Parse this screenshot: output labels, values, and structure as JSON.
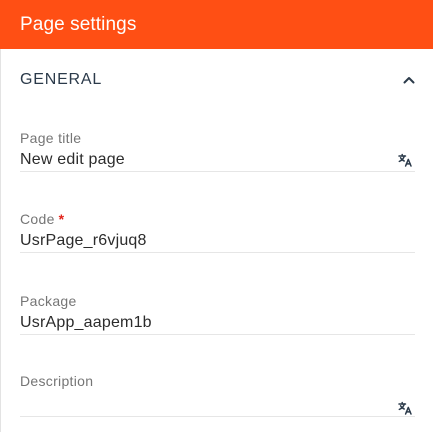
{
  "header": {
    "title": "Page settings"
  },
  "section": {
    "title": "GENERAL",
    "toggle_icon": "chevron-up-icon"
  },
  "fields": {
    "page_title": {
      "label": "Page title",
      "value": "New edit page",
      "icon": "translate-icon"
    },
    "code": {
      "label": "Code",
      "required_mark": "*",
      "value": "UsrPage_r6vjuq8"
    },
    "package": {
      "label": "Package",
      "value": "UsrApp_aapem1b"
    },
    "description": {
      "label": "Description",
      "value": "",
      "icon": "translate-icon"
    }
  },
  "colors": {
    "header_bg": "#ff4f14",
    "required": "#e2231a"
  }
}
